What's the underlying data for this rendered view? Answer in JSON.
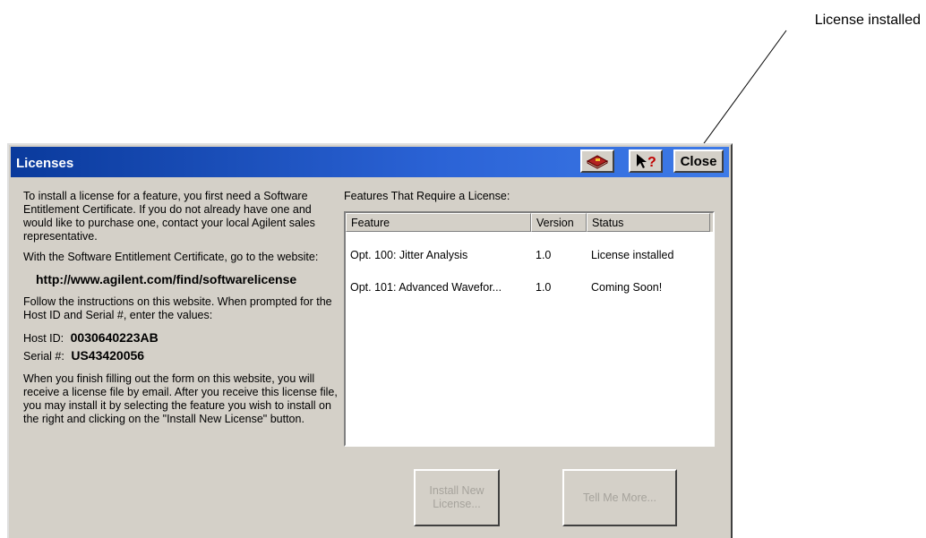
{
  "callout": {
    "text": "License installed"
  },
  "window": {
    "title": "Licenses",
    "close_label": "Close"
  },
  "instructions": {
    "para1": "To install a license for a feature, you first need a Software Entitlement Certificate.  If you do not already have one and would like to purchase one, contact your local Agilent sales representative.",
    "para2": "With the Software Entitlement Certificate, go to the website:",
    "url": "http://www.agilent.com/find/softwarelicense",
    "para3": "Follow the instructions on this website.  When prompted for the Host ID and Serial #, enter the values:",
    "host_id_label": "Host ID:",
    "host_id_value": "0030640223AB",
    "serial_label": "Serial #:",
    "serial_value": "US43420056",
    "para4": "When you finish filling out the form on this website, you will receive a license file by email.  After you receive this license file, you may install it by selecting the feature you wish to install on the right and clicking on the \"Install New License\" button."
  },
  "features": {
    "label": "Features That Require a License:",
    "columns": [
      "Feature",
      "Version",
      "Status"
    ],
    "rows": [
      {
        "feature": "Opt. 100: Jitter Analysis",
        "version": "1.0",
        "status": "License installed"
      },
      {
        "feature": "Opt. 101: Advanced Wavefor...",
        "version": "1.0",
        "status": "Coming Soon!"
      }
    ]
  },
  "buttons": {
    "install_line1": "Install New",
    "install_line2": "License...",
    "tell_me_more": "Tell Me More..."
  },
  "icons": {
    "book": "book-icon",
    "help": "context-help-icon"
  }
}
